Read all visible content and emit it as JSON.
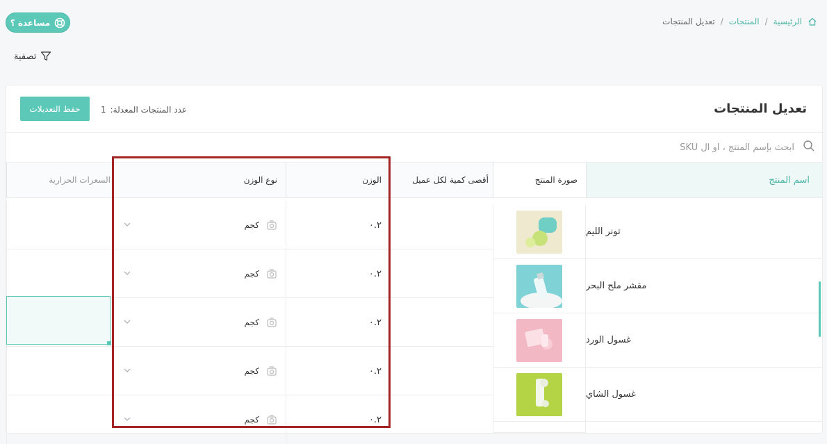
{
  "help": {
    "label": "مساعدة ؟"
  },
  "breadcrumb": {
    "home": "الرئيسية",
    "sep": "/",
    "products": "المنتجات",
    "current": "تعديل المنتجات"
  },
  "filter": {
    "label": "تصفية"
  },
  "page": {
    "title": "تعديل المنتجات"
  },
  "toolbar": {
    "save_label": "حفظ التعديلات",
    "modified_label": "عدد المنتجات المعدلة:",
    "modified_count": "1"
  },
  "search": {
    "placeholder": "ابحث بإسم المنتج ، او ال SKU"
  },
  "table": {
    "headers": {
      "name": "اسم المنتج",
      "image": "صورة المنتج",
      "max_qty": "أقصى كمية لكل عميل",
      "weight": "الوزن",
      "weight_type": "نوع الوزن",
      "calories": "السعرات الحرارية"
    },
    "products": [
      {
        "name": "تونر الليم"
      },
      {
        "name": "مقشر ملح البحر"
      },
      {
        "name": "غسول الورد"
      },
      {
        "name": "غسول الشاي"
      }
    ],
    "rows": [
      {
        "weight": "٠.٢",
        "weight_type": "كجم"
      },
      {
        "weight": "٠.٢",
        "weight_type": "كجم"
      },
      {
        "weight": "٠.٢",
        "weight_type": "كجم"
      },
      {
        "weight": "٠.٢",
        "weight_type": "كجم"
      },
      {
        "weight": "٠.٢",
        "weight_type": "كجم"
      }
    ]
  },
  "colors": {
    "accent": "#5cc8b8",
    "highlight": "#a32424"
  }
}
